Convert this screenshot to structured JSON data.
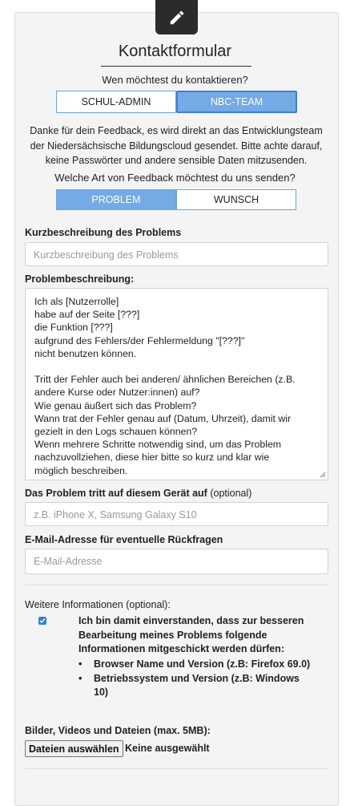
{
  "header": {
    "title": "Kontaktformular",
    "edit_icon": "pencil-icon"
  },
  "recipient": {
    "question": "Wen möchtest du kontaktieren?",
    "options": [
      "SCHUL-ADMIN",
      "NBC-TEAM"
    ],
    "selected": "NBC-TEAM"
  },
  "intro_text": "Danke für dein Feedback, es wird direkt an das Entwicklungsteam der Niedersächsische Bildungscloud gesendet. Bitte achte darauf, keine Passwörter und andere sensible Daten mitzusenden.",
  "feedback_type": {
    "question": "Welche Art von Feedback möchtest du uns senden?",
    "options": [
      "PROBLEM",
      "WUNSCH"
    ],
    "selected": "PROBLEM"
  },
  "short_description": {
    "label": "Kurzbeschreibung des Problems",
    "placeholder": "Kurzbeschreibung des Problems"
  },
  "problem_description": {
    "label": "Problembeschreibung:",
    "lines": [
      "Ich als [Nutzerrolle]",
      "habe auf der Seite [???]",
      "die Funktion [???]",
      "aufgrund des Fehlers/der Fehlermeldung \"[???]\"",
      "nicht benutzen können.",
      "",
      "Tritt der Fehler auch bei anderen/ ähnlichen Bereichen (z.B.",
      "andere Kurse oder Nutzer:innen) auf?",
      "Wie genau äußert sich das Problem?",
      "Wann trat der Fehler genau auf (Datum, Uhrzeit), damit wir",
      "gezielt in den Logs schauen können?",
      "Wenn mehrere Schritte notwendig sind, um das Problem",
      "nachzuvollziehen, diese hier bitte so kurz und klar wie",
      "möglich beschreiben."
    ]
  },
  "device": {
    "label": "Das Problem tritt auf diesem Gerät auf",
    "optional_note": "(optional)",
    "placeholder": "z.B. iPhone X, Samsung Galaxy S10"
  },
  "email": {
    "label": "E-Mail-Adresse für eventuelle Rückfragen",
    "placeholder": "E-Mail-Adresse"
  },
  "further_info": {
    "label": "Weitere Informationen (optional):",
    "consent_checked": true,
    "consent_text": "Ich bin damit einverstanden, dass zur besseren Bearbeitung meines Problems folgende Informationen mitgeschickt werden dürfen:",
    "bullets": [
      "Browser Name und Version (z.B: Firefox 69.0)",
      "Betriebssystem und Version (z.B: Windows 10)"
    ]
  },
  "files": {
    "label": "Bilder, Videos und Dateien (max. 5MB):",
    "button_label": "Dateien auswählen",
    "status": "Keine ausgewählt"
  },
  "colors": {
    "accent": "#74aae6",
    "accent_border": "#6aa4e0",
    "badge": "#2b2b2b",
    "checkbox": "#2f7fe3"
  }
}
